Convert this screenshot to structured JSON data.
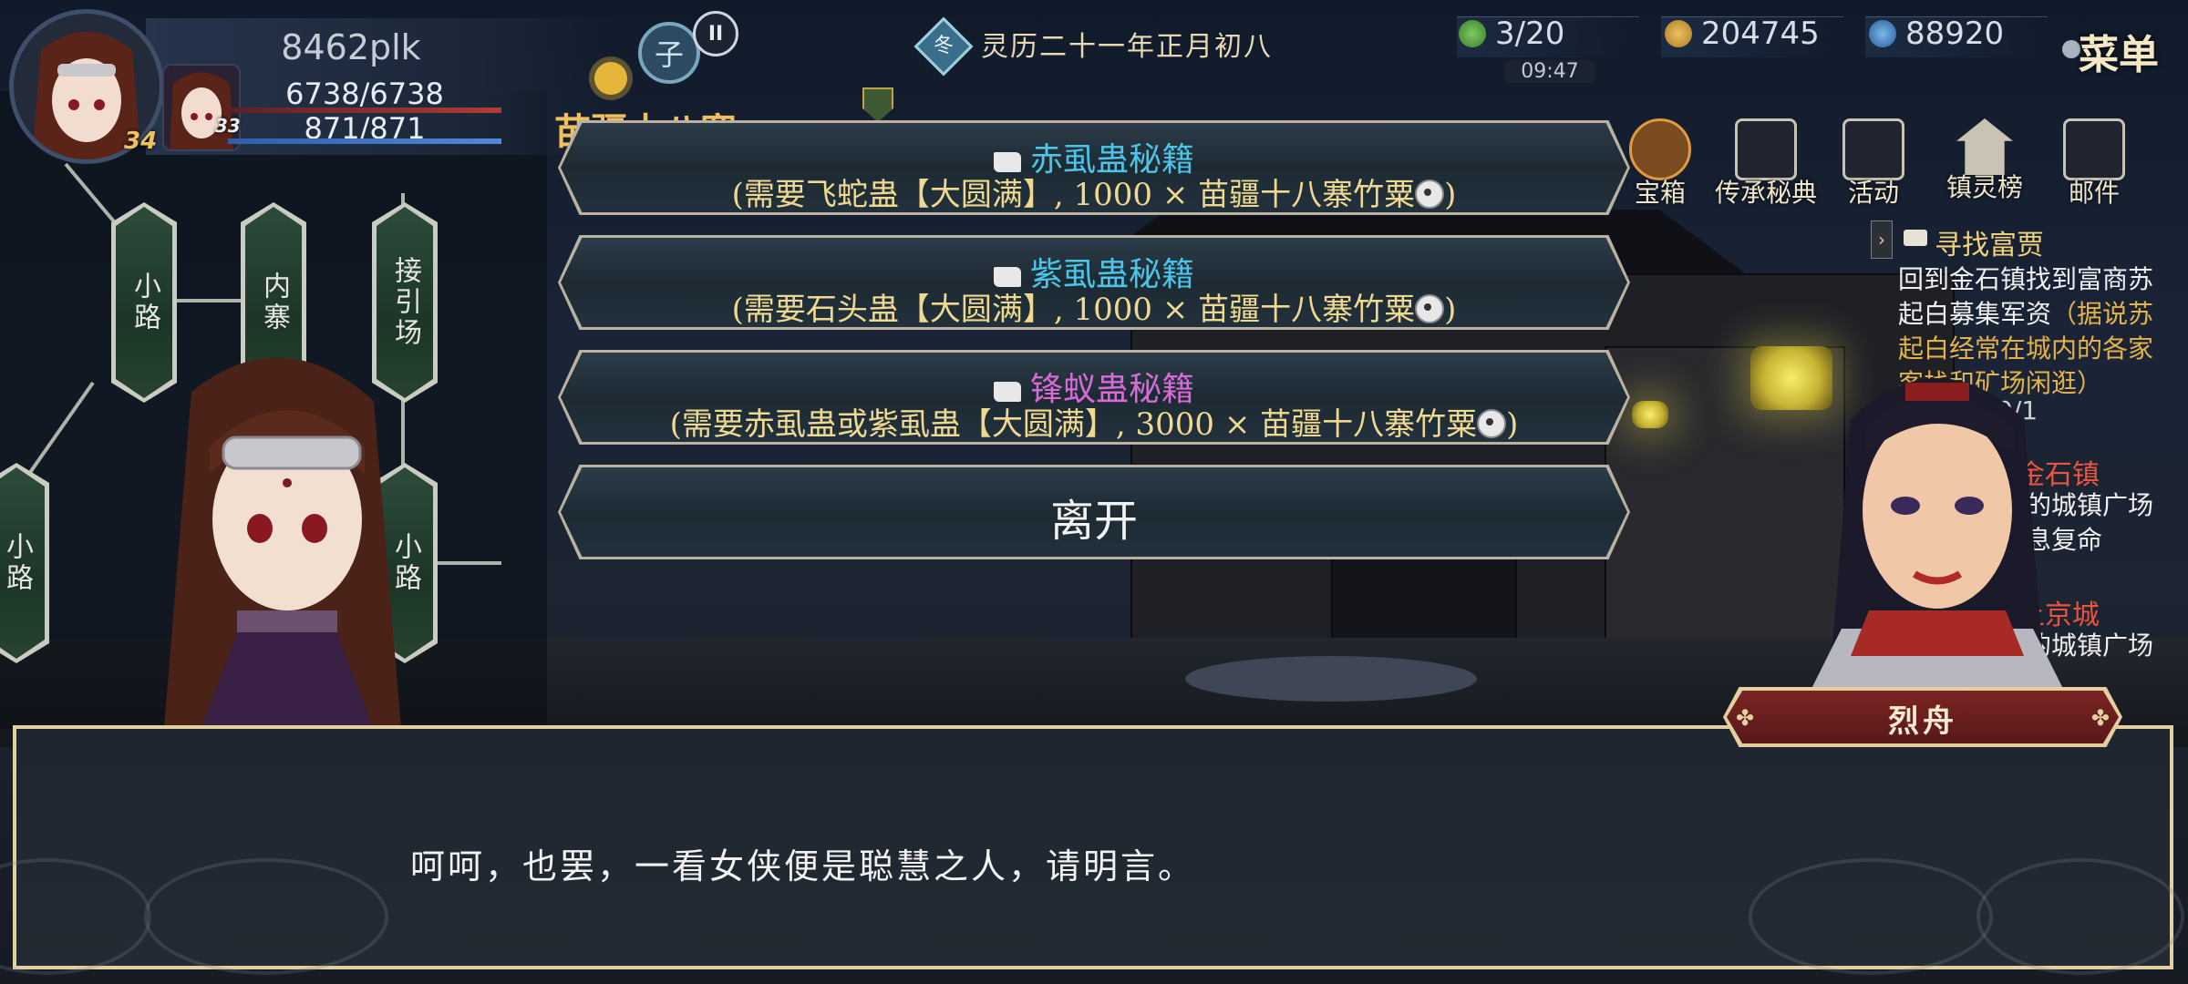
{
  "player": {
    "name": "8462plk",
    "hp": "6738/6738",
    "mp": "871/871",
    "level_main": "34",
    "level_pet": "33",
    "time_button_label": "子",
    "pause_label": "II"
  },
  "date": {
    "season_glyph": "冬",
    "text": "灵历二十一年正月初八"
  },
  "resources": {
    "stamina": "3/20",
    "coins": "204745",
    "spirit": "88920",
    "clock": "09:47"
  },
  "menu_label": "菜单",
  "location_partial": "苗疆十八寨",
  "top_icons": [
    {
      "label": "宝箱",
      "icon": "chest-icon"
    },
    {
      "label": "传承秘典",
      "icon": "tome-icon"
    },
    {
      "label": "活动",
      "icon": "gift-icon"
    },
    {
      "label": "镇灵榜",
      "icon": "pagoda-icon"
    },
    {
      "label": "邮件",
      "icon": "mail-icon"
    }
  ],
  "map_nodes": [
    {
      "label": "小路"
    },
    {
      "label": "内寨"
    },
    {
      "label": "接引场"
    },
    {
      "label": "小路"
    },
    {
      "label": "小路"
    }
  ],
  "quest": {
    "arrow": "›",
    "title": "寻找富贾",
    "body": "回到金石镇找到富商苏起白募集军资",
    "hint": "（据说苏起白经常在城内的各家客栈和矿场闲逛）",
    "progress": "0/1",
    "q2_title": "打探情况-金石镇",
    "q2_body": "前往金石镇的城镇广场找人打听消息复命",
    "q3_title": "送信传书-上京城",
    "q3_body": "前往上京城的城镇广场找"
  },
  "options": [
    {
      "title": "赤虱蛊秘籍",
      "title_color": "#4cc4e6",
      "requirement": "(需要飞蛇蛊【大圆满】, 1000 × 苗疆十八寨竹粟",
      "req_end": ")"
    },
    {
      "title": "紫虱蛊秘籍",
      "title_color": "#4cc4e6",
      "requirement": "(需要石头蛊【大圆满】, 1000 × 苗疆十八寨竹粟",
      "req_end": ")"
    },
    {
      "title": "锋蚁蛊秘籍",
      "title_color": "#d66bd6",
      "requirement": "(需要赤虱蛊或紫虱蛊【大圆满】, 3000 × 苗疆十八寨竹粟",
      "req_end": ")"
    }
  ],
  "leave_label": "离开",
  "dialog": {
    "speaker": "烈舟",
    "text": "呵呵，也罢，一看女侠便是聪慧之人，请明言。"
  }
}
